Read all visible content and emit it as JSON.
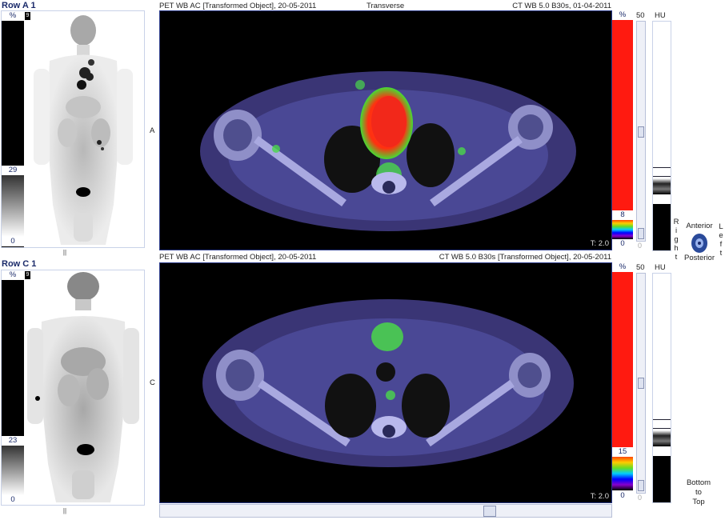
{
  "rows": [
    {
      "title": "Row A 1",
      "row_letter": "A",
      "pet_header": "PET WB AC [Transformed Object], 20-05-2011",
      "center_header": "Transverse",
      "ct_header": "CT WB  5.0  B30s, 01-04-2011",
      "mip": {
        "pct": "%",
        "icon": "9",
        "upper": "29",
        "lower": "0",
        "handle": "||"
      },
      "colorbar": {
        "pct": "%",
        "upper": "8",
        "lower": "0"
      },
      "slider": {
        "top": "50",
        "bottom": "0",
        "level": 0.48
      },
      "hu": {
        "label": "HU"
      },
      "t_value": "T: 2.0"
    },
    {
      "title": "Row C 1",
      "row_letter": "C",
      "pet_header": "PET WB AC [Transformed Object], 20-05-2011",
      "ct_header": "CT WB  5.0  B30s [Transformed Object], 20-05-2011",
      "mip": {
        "pct": "%",
        "icon": "9",
        "upper": "23",
        "lower": "0",
        "handle": "||"
      },
      "colorbar": {
        "pct": "%",
        "upper": "15",
        "lower": "0"
      },
      "slider": {
        "top": "50",
        "bottom": "0",
        "level": 0.48
      },
      "hu": {
        "label": "HU"
      },
      "t_value": "T: 2.0"
    }
  ],
  "orientation": {
    "right_letters": [
      "R",
      "i",
      "g",
      "h",
      "t"
    ],
    "left_letters": [
      "L",
      "e",
      "f",
      "t"
    ],
    "anterior": "Anterior",
    "posterior": "Posterior",
    "bottom_to_top": [
      "Bottom",
      "to",
      "Top"
    ]
  },
  "colors": {
    "accent_blue": "#1a2a6a",
    "pet_hot": "#ff1a10"
  }
}
